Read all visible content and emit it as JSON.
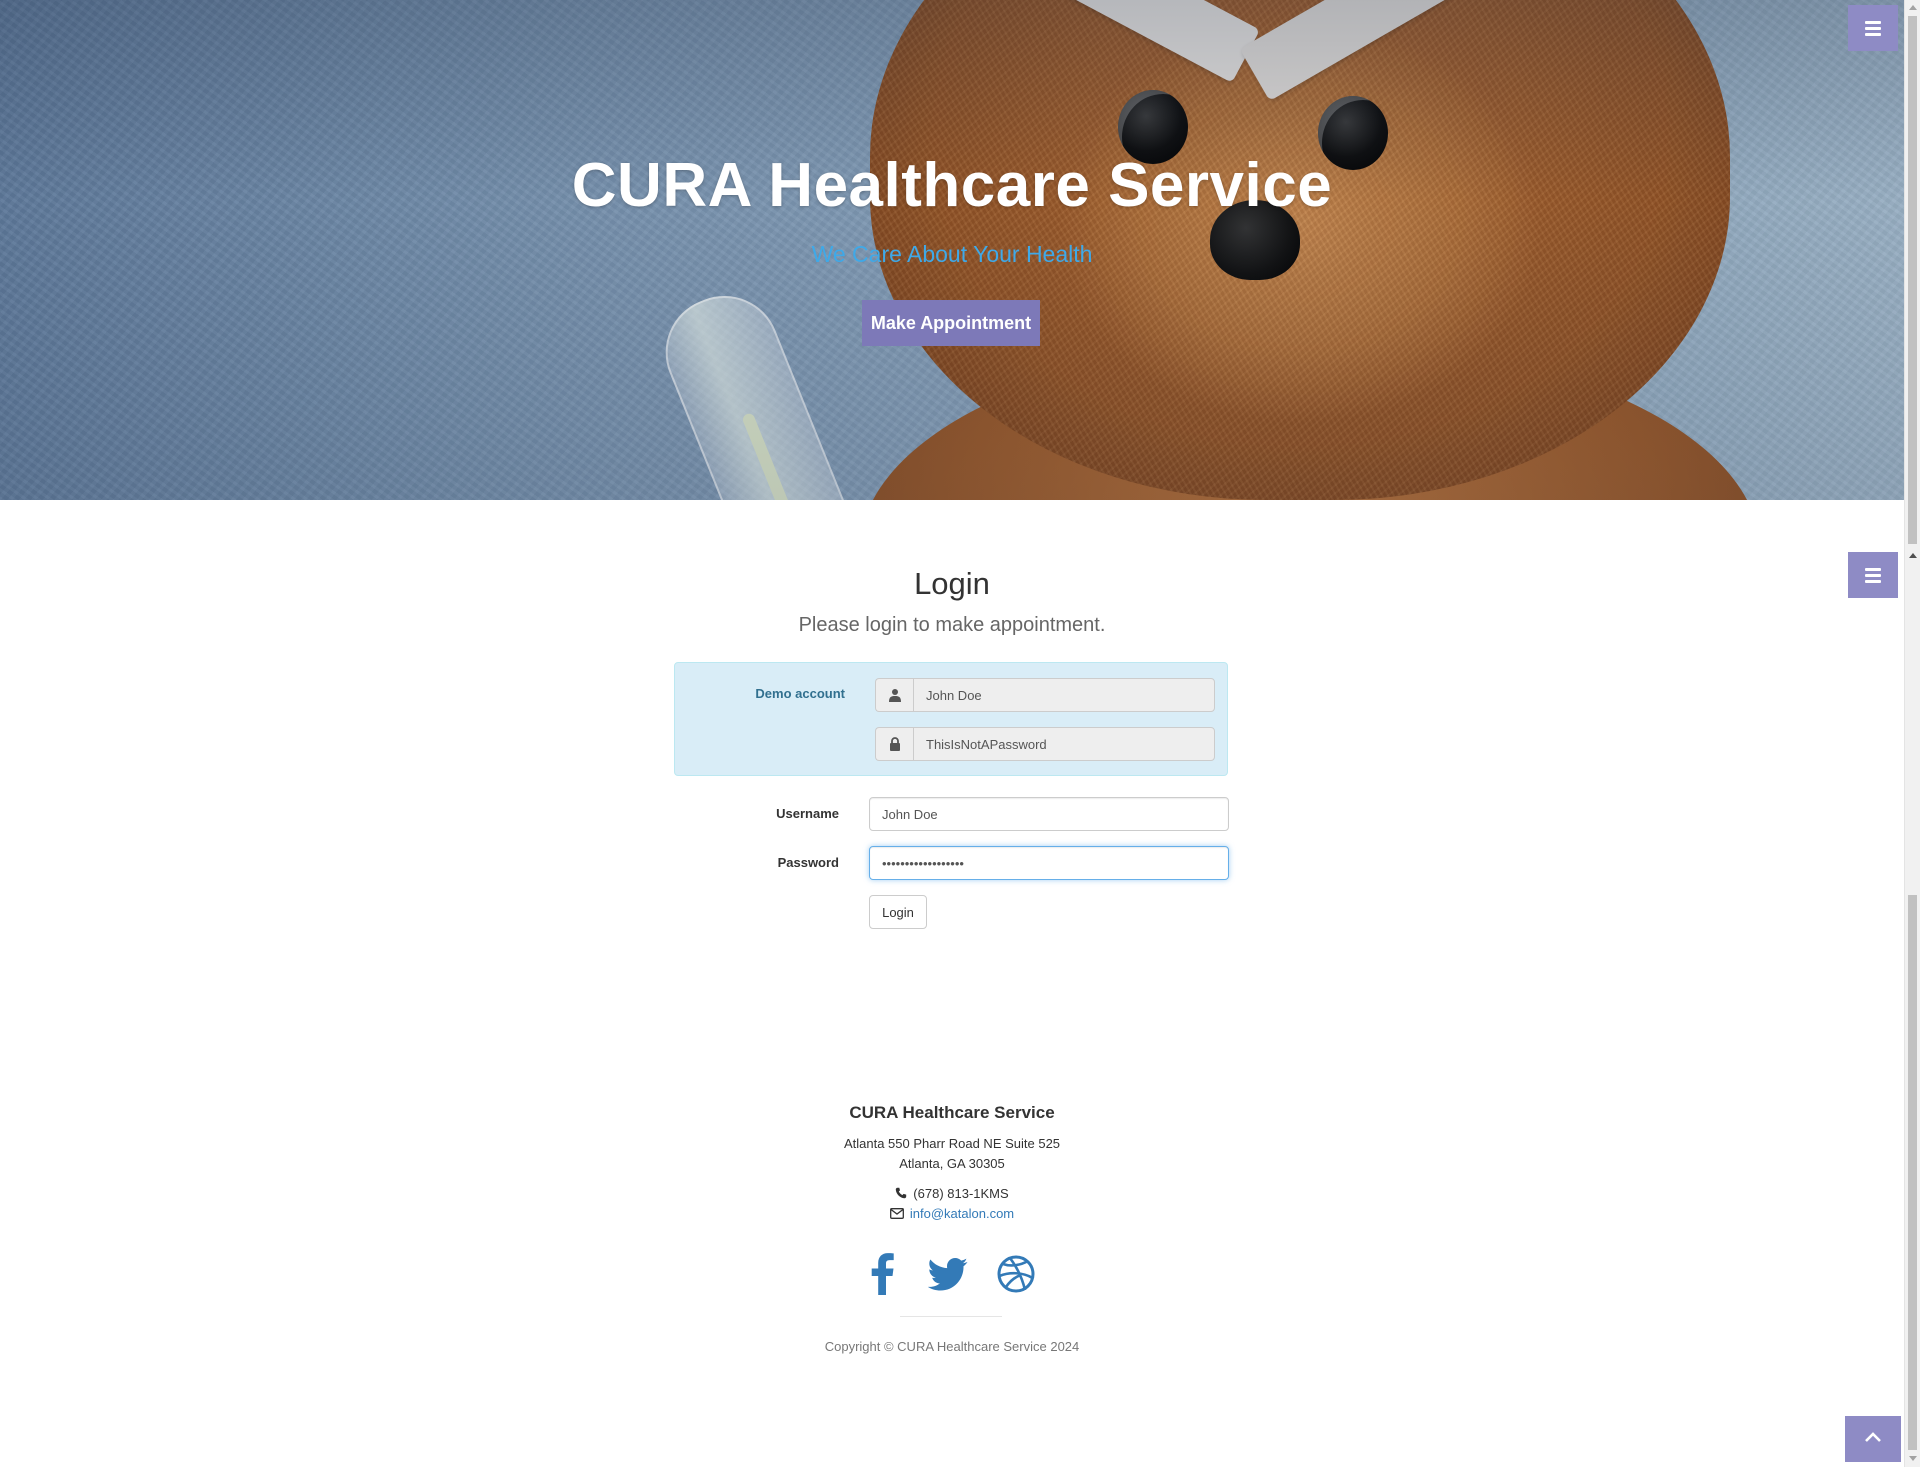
{
  "hero": {
    "title": "CURA Healthcare Service",
    "subtitle": "We Care About Your Health",
    "cta_label": "Make Appointment"
  },
  "nav": {
    "menu_icon": "bars-icon"
  },
  "login": {
    "heading": "Login",
    "subheading": "Please login to make appointment.",
    "demo": {
      "label": "Demo account",
      "username": "John Doe",
      "password": "ThisIsNotAPassword",
      "user_icon": "user-icon",
      "lock_icon": "lock-icon"
    },
    "username_label": "Username",
    "username_value": "John Doe",
    "password_label": "Password",
    "password_value": "ThisIsNotAPassword",
    "submit_label": "Login"
  },
  "footer": {
    "title": "CURA Healthcare Service",
    "address_line1": "Atlanta 550 Pharr Road NE Suite 525",
    "address_line2": "Atlanta, GA 30305",
    "phone": "(678) 813-1KMS",
    "email": "info@katalon.com",
    "social": [
      "facebook-icon",
      "twitter-icon",
      "dribbble-icon"
    ],
    "copyright": "Copyright © CURA Healthcare Service 2024"
  },
  "colors": {
    "accent": "#7d79b8",
    "menu_button": "#8e8bc5",
    "subtitle": "#3fa9e8",
    "demo_box_bg": "#d9edf7",
    "demo_label": "#31708f",
    "link": "#337ab7",
    "social_icon": "#337ab7"
  }
}
